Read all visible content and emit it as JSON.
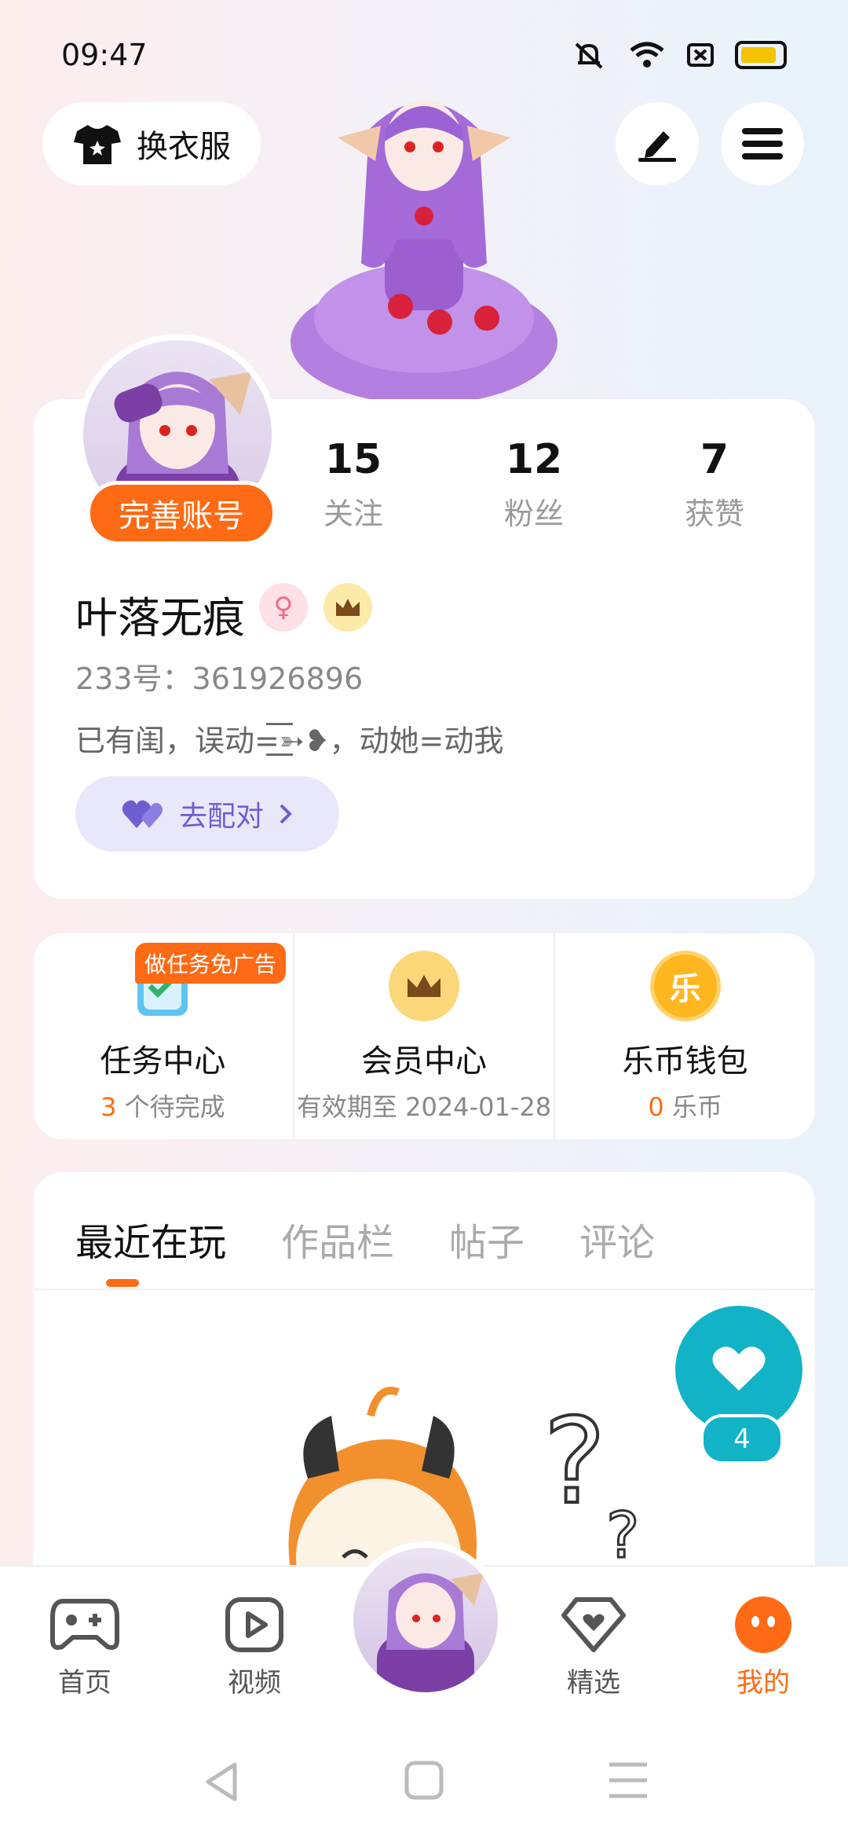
{
  "status_bar": {
    "time": "09:47"
  },
  "top_bar": {
    "outfit_label": "换衣服"
  },
  "profile": {
    "complete_label": "完善账号",
    "stats": [
      {
        "value": "15",
        "label": "关注"
      },
      {
        "value": "12",
        "label": "粉丝"
      },
      {
        "value": "7",
        "label": "获赞"
      }
    ],
    "username": "叶落无痕",
    "uid": "233号：361926896",
    "bio": "已有闺，误动=͟͟͞͞➳❥，动她=动我",
    "pair_label": "去配对"
  },
  "services": {
    "ad_tag": "做任务免广告",
    "items": [
      {
        "title": "任务中心",
        "highlight": "3",
        "sub": " 个待完成"
      },
      {
        "title": "会员中心",
        "highlight": "",
        "sub": "有效期至 2024-01-28"
      },
      {
        "title": "乐币钱包",
        "highlight": "0",
        "sub": " 乐币"
      }
    ],
    "wallet_icon_char": "乐"
  },
  "content": {
    "tabs": [
      "最近在玩",
      "作品栏",
      "帖子",
      "评论"
    ],
    "active_tab": 0,
    "like_count": "4"
  },
  "bottom_nav": {
    "items": [
      {
        "label": "首页",
        "icon": "gamepad-icon"
      },
      {
        "label": "视频",
        "icon": "play-icon"
      },
      {
        "label": "精选",
        "icon": "heart-diamond-icon"
      },
      {
        "label": "我的",
        "icon": "face-icon"
      }
    ],
    "active": 3
  },
  "colors": {
    "accent": "#ff6a14",
    "teal": "#12b3c7",
    "purple": "#6d5fcf"
  }
}
